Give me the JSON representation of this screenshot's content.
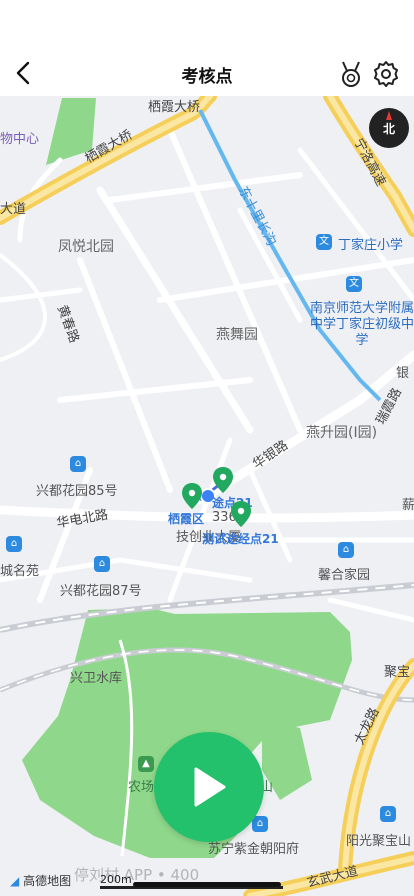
{
  "header": {
    "title": "考核点"
  },
  "icons": {
    "back": "chevron-left-icon",
    "medal": "medal-icon",
    "settings": "gear-icon",
    "compass": "compass-icon",
    "play": "play-icon"
  },
  "compass": {
    "label": "北"
  },
  "colors": {
    "primary_green": "#23c16b",
    "park_green": "#8fd78a",
    "road_yellow": "#f5cf59",
    "river_blue": "#65b8ef"
  },
  "map": {
    "labels": {
      "qixia_bridge_top": "栖霞大桥",
      "center_cut": "物中心",
      "qixia_bridge": "栖霞大桥",
      "highway_right": "宁洛高速",
      "dadao_left": "大道",
      "river": "东十里长沟",
      "fengyue": "凤悦北园",
      "dingjia_primary": "丁家庄小学",
      "huangchun_road": "黄春路",
      "yanwu": "燕舞园",
      "nanjing_school": "南京师范大学附属中学丁家庄初级中学",
      "ruixia": "瑞霞路",
      "yin_cut": "银",
      "yansheng": "燕升园(I园)",
      "huayin": "华银路",
      "xingdu85": "兴都花园85号",
      "checkpoint_a": "途点21",
      "qixia_district": "栖霞区",
      "num_336": "336",
      "xue_cut": "薪",
      "huadian_north": "华电北路",
      "jichuang": "技创业大厦",
      "test_point": "测试途经点21",
      "chengming": "城名苑",
      "xingdu87": "兴都花园87号",
      "xinhe": "馨合家园",
      "xingwei": "兴卫水库",
      "ju_cut": "聚宝",
      "tailong": "太龙路",
      "nongchang": "农场",
      "shan": "山",
      "yangguang": "阳光聚宝山",
      "suning": "苏宁紫金朝阳府",
      "xuanwu": "玄武大道"
    }
  },
  "footer": {
    "logo": "高德地图",
    "scale": "200m",
    "watermark": "停刘村 APP • 400"
  }
}
